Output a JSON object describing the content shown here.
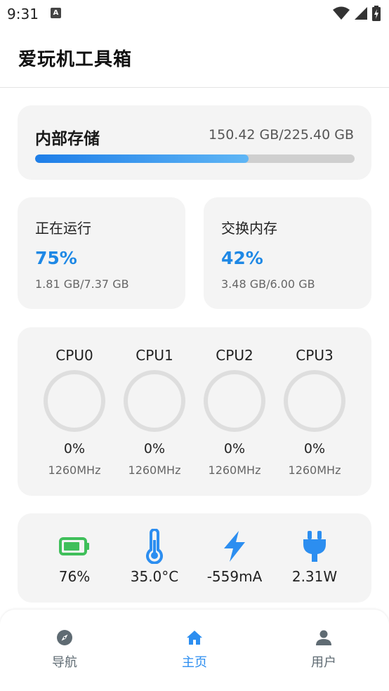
{
  "status_bar": {
    "time": "9:31",
    "notification_icon": "a-letter-icon"
  },
  "app_bar": {
    "title": "爱玩机工具箱"
  },
  "storage": {
    "title": "内部存储",
    "value": "150.42 GB/225.40 GB",
    "used_fraction": 0.6673
  },
  "memory": {
    "running": {
      "title": "正在运行",
      "percent": "75%",
      "detail": "1.81 GB/7.37 GB"
    },
    "swap": {
      "title": "交换内存",
      "percent": "42%",
      "detail": "3.48 GB/6.00 GB"
    }
  },
  "cpus": [
    {
      "name": "CPU0",
      "percent": "0%",
      "freq": "1260MHz",
      "load": 0
    },
    {
      "name": "CPU1",
      "percent": "0%",
      "freq": "1260MHz",
      "load": 0
    },
    {
      "name": "CPU2",
      "percent": "0%",
      "freq": "1260MHz",
      "load": 0
    },
    {
      "name": "CPU3",
      "percent": "0%",
      "freq": "1260MHz",
      "load": 0
    }
  ],
  "battery_stats": [
    {
      "icon": "battery-icon",
      "value": "76%"
    },
    {
      "icon": "thermometer-icon",
      "value": "35.0°C"
    },
    {
      "icon": "lightning-icon",
      "value": "-559mA"
    },
    {
      "icon": "plug-icon",
      "value": "2.31W"
    }
  ],
  "nav": [
    {
      "icon": "compass-icon",
      "label": "导航",
      "active": false
    },
    {
      "icon": "home-icon",
      "label": "主页",
      "active": true
    },
    {
      "icon": "person-icon",
      "label": "用户",
      "active": false
    }
  ],
  "colors": {
    "accent": "#1e88e5",
    "battery": "#3fbf5a",
    "icon_blue": "#2c8ef0",
    "nav_inactive": "#5f6b73",
    "ring_track": "#dedede"
  }
}
